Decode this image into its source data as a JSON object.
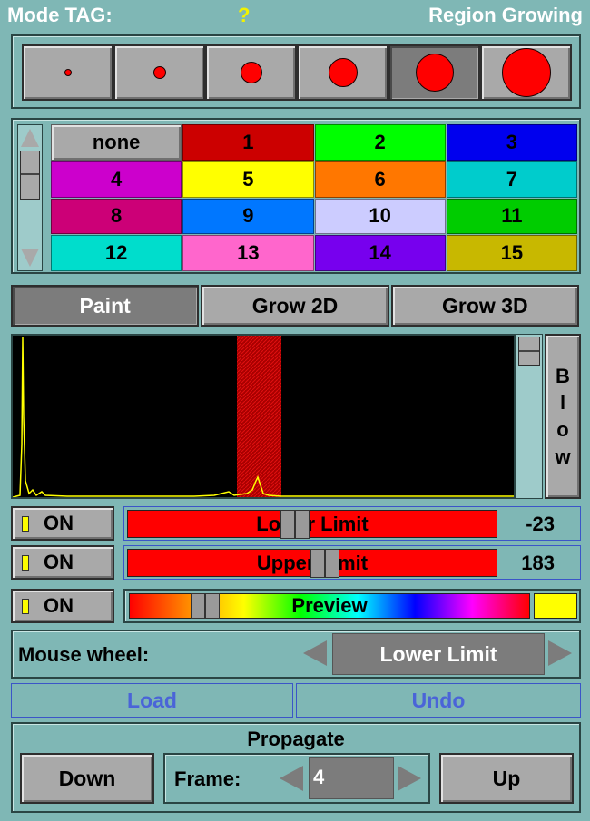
{
  "header": {
    "mode_label": "Mode TAG:",
    "help": "?",
    "title": "Region Growing"
  },
  "brushes": {
    "sizes": [
      1,
      2,
      3,
      4,
      5,
      6
    ],
    "selected_index": 4
  },
  "colors": [
    {
      "label": "none",
      "color": "#a9a9a9"
    },
    {
      "label": "1",
      "color": "#cc0000"
    },
    {
      "label": "2",
      "color": "#00ff00"
    },
    {
      "label": "3",
      "color": "#0000ee"
    },
    {
      "label": "4",
      "color": "#cc00cc"
    },
    {
      "label": "5",
      "color": "#ffff00"
    },
    {
      "label": "6",
      "color": "#ff7700"
    },
    {
      "label": "7",
      "color": "#00cccc"
    },
    {
      "label": "8",
      "color": "#cc0077"
    },
    {
      "label": "9",
      "color": "#0077ff"
    },
    {
      "label": "10",
      "color": "#ccccff"
    },
    {
      "label": "11",
      "color": "#00cc00"
    },
    {
      "label": "12",
      "color": "#00ddcc"
    },
    {
      "label": "13",
      "color": "#ff66cc"
    },
    {
      "label": "14",
      "color": "#7700ee"
    },
    {
      "label": "15",
      "color": "#c8b800"
    }
  ],
  "modes": {
    "paint": "Paint",
    "grow2d": "Grow 2D",
    "grow3d": "Grow 3D",
    "active": "paint"
  },
  "histogram": {
    "blow_label": "B l o w",
    "selection_color": "#cc0000"
  },
  "lower": {
    "on_label": "ON",
    "label": "Lower Limit",
    "value": "-23",
    "position": 0.33
  },
  "upper": {
    "on_label": "ON",
    "label": "Upper Limit",
    "value": "183",
    "position": 0.54
  },
  "preview": {
    "on_label": "ON",
    "label": "Preview",
    "position": 0.2,
    "swatch_color": "#ffff00"
  },
  "mouse_wheel": {
    "label": "Mouse wheel:",
    "value": "Lower Limit"
  },
  "actions": {
    "load": "Load",
    "undo": "Undo"
  },
  "propagate": {
    "title": "Propagate",
    "down": "Down",
    "up": "Up",
    "frame_label": "Frame:",
    "frame_value": "4"
  }
}
